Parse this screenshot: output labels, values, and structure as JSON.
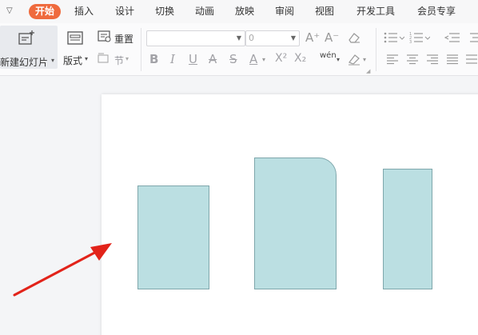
{
  "menu": {
    "collapse_icon": "chevron-down-icon",
    "tabs": [
      {
        "label": "开始",
        "active": true
      },
      {
        "label": "插入"
      },
      {
        "label": "设计"
      },
      {
        "label": "切换"
      },
      {
        "label": "动画"
      },
      {
        "label": "放映"
      },
      {
        "label": "审阅"
      },
      {
        "label": "视图"
      },
      {
        "label": "开发工具"
      },
      {
        "label": "会员专享"
      }
    ]
  },
  "ribbon": {
    "new_slide_label": "新建幻灯片",
    "layout_label": "版式",
    "reset_label": "重置",
    "section_label": "节",
    "font_size_value": "0",
    "pinyin_label": "wén",
    "bold_label": "B",
    "italic_label": "I",
    "underline_label": "U",
    "strike_label": "S",
    "font_color_label": "A",
    "superscript_label": "X²",
    "subscript_label": "X₂",
    "grow_font_label": "A⁺",
    "shrink_font_label": "A⁻"
  },
  "colors": {
    "accent": "#ef6a3d",
    "shape_fill": "#bbdfe2",
    "shape_border": "#7fa7ac",
    "arrow": "#e2231a"
  },
  "slide": {
    "shapes": [
      "rectangle",
      "round-corner-rectangle",
      "rectangle"
    ],
    "annotation": "red-arrow"
  }
}
